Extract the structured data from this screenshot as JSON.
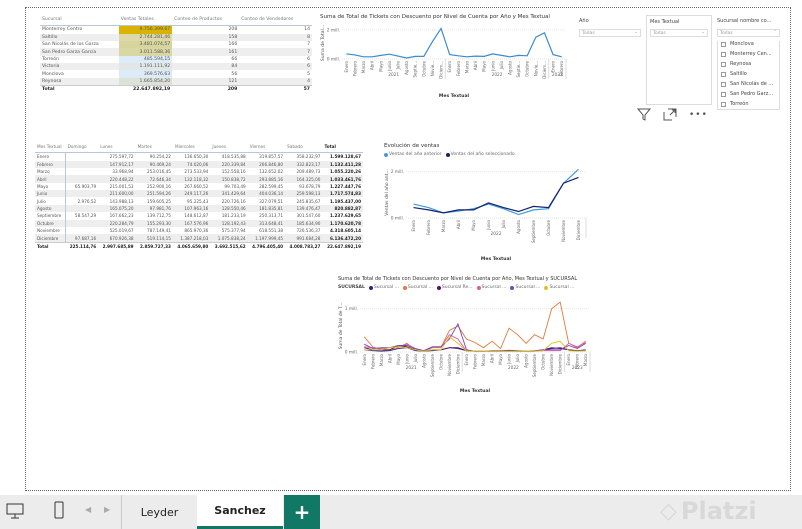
{
  "sales_table": {
    "headers": [
      "Sucursal",
      "Ventas Totales",
      "Conteo de Productos",
      "Conteo de Vendedores"
    ],
    "rows": [
      [
        "Monterrey Centro",
        "9.756.399,67",
        "208",
        "14"
      ],
      [
        "Saltillo",
        "2.744.281,46",
        "158",
        "8"
      ],
      [
        "San Nicolás de los Garza",
        "3.481.074,57",
        "166",
        "7"
      ],
      [
        "San Pedro Garza García",
        "3.011.588,36",
        "161",
        "7"
      ],
      [
        "Torreón",
        "485.594,15",
        "66",
        "6"
      ],
      [
        "Victoria",
        "1.191.111,92",
        "84",
        "6"
      ],
      [
        "Monclova",
        "369.576,63",
        "56",
        "5"
      ],
      [
        "Reynosa",
        "1.665.854,20",
        "121",
        "4"
      ]
    ],
    "total": [
      "Total",
      "22.647.892,19",
      "209",
      "57"
    ],
    "bar_colors": [
      "#d9b300",
      "#dcd9a8",
      "#d7d49e",
      "#d9d7a3",
      "#ddeaf7",
      "#e1e6e6",
      "#ddeaf7",
      "#dde2d8"
    ]
  },
  "matrix": {
    "headers": [
      "Mes Textual",
      "Domingo",
      "Lunes",
      "Martes",
      "Miercoles",
      "Jueves",
      "Viernes",
      "Sabado",
      "Total"
    ],
    "rows": [
      [
        "Enero",
        "",
        "275.597,72",
        "90.254,22",
        "136.650,30",
        "418.535,88",
        "319.857,57",
        "358.232,97",
        "1.599.128,67"
      ],
      [
        "Febrero",
        "",
        "147.912,17",
        "90.469,24",
        "74.020,06",
        "220.339,84",
        "266.846,80",
        "332.823,17",
        "1.132.411,28"
      ],
      [
        "Marzo",
        "",
        "33.968,94",
        "253.016,45",
        "273.533,94",
        "152.558,16",
        "132.652,02",
        "209.489,73",
        "1.055.220,26"
      ],
      [
        "Abril",
        "",
        "220.448,22",
        "72.646,34",
        "132.118,32",
        "150.838,72",
        "293.885,16",
        "164.325,00",
        "1.033.461,76"
      ],
      [
        "Mayo",
        "65.903,79",
        "215.001,53",
        "252.900,16",
        "267.660,52",
        "99.703,49",
        "282.599,45",
        "93.678,79",
        "1.227.447,76"
      ],
      [
        "Junio",
        "",
        "211.600,00",
        "251.594,26",
        "249.117,26",
        "341.429,64",
        "404.036,14",
        "259.598,13",
        "1.717.574,83"
      ],
      [
        "Julio",
        "2.976,52",
        "143.988,13",
        "159.605,25",
        "95.225,43",
        "220.726,16",
        "327.079,51",
        "245.835,67",
        "1.195.437,00"
      ],
      [
        "Agosto",
        "",
        "165.075,20",
        "97.981,76",
        "107.963,16",
        "128.550,46",
        "181.835,81",
        "139.476,47",
        "820.882,87"
      ],
      [
        "Septiembre",
        "58.547,29",
        "167.662,23",
        "139.712,75",
        "148.612,87",
        "181.233,19",
        "250.313,71",
        "301.547,60",
        "1.237.629,65"
      ],
      [
        "Octubre",
        "",
        "220.284,79",
        "155.293,30",
        "167.576,96",
        "128.192,43",
        "313.648,41",
        "185.634,90",
        "1.170.620,78"
      ],
      [
        "Noviembre",
        "",
        "525.019,67",
        "787.149,41",
        "865.970,36",
        "575.377,94",
        "618.551,38",
        "726.536,37",
        "4.318.605,14"
      ],
      [
        "Diciembre",
        "97.687,16",
        "670.926,38",
        "519.114,15",
        "1.387.218,03",
        "1.075.838,24",
        "1.197.999,45",
        "991.684,28",
        "6.136.472,20"
      ]
    ],
    "total": [
      "Total",
      "225.114,76",
      "2.997.685,89",
      "2.859.727,33",
      "4.065.659,80",
      "3.692.515,62",
      "4.796.405,40",
      "4.008.783,27",
      "22.647.892,19"
    ]
  },
  "slicers": {
    "year": {
      "label": "Año",
      "value": "Todas"
    },
    "month": {
      "label": "Mes Textual",
      "value": "Todas"
    },
    "branch": {
      "label": "Sucursal nombre co...",
      "value": "Todas",
      "items": [
        "Monclova",
        "Monterrey Cen...",
        "Reynosa",
        "Saltillo",
        "San Nicolás de ...",
        "San Pedro Garz...",
        "Torreón"
      ]
    }
  },
  "chart_data": [
    {
      "type": "line",
      "title": "Suma de Total de Tickets con Descuento por Nivel de Cuenta por Año y Mes Textual",
      "xlabel": "Mes Textual",
      "ylabel": "Suma de Total...",
      "yticks": [
        "0 mill.",
        "2 mill."
      ],
      "ylim": [
        0,
        2.2
      ],
      "x": [
        "Enero",
        "Febrero",
        "Marzo",
        "Abril",
        "Mayo",
        "Junio",
        "Julio",
        "Agosto",
        "Septie...",
        "Octubre",
        "Novie...",
        "Diciem...",
        "Enero",
        "Febrero",
        "Marzo",
        "Abril",
        "Mayo",
        "Junio",
        "Julio",
        "Agosto",
        "Septie...",
        "Octubre",
        "Novie...",
        "Diciem...",
        "Enero",
        "Febrero"
      ],
      "groups": [
        {
          "label": "2021",
          "n": 12
        },
        {
          "label": "2022",
          "n": 12
        },
        {
          "label": "2023",
          "n": 2
        }
      ],
      "series": [
        {
          "name": "Total",
          "color": "#3a8ad1",
          "values": [
            0.35,
            0.28,
            0.15,
            0.15,
            0.25,
            0.33,
            0.2,
            0.07,
            0.18,
            0.18,
            1.2,
            2.1,
            0.3,
            0.22,
            0.15,
            0.2,
            0.18,
            0.35,
            0.25,
            0.15,
            0.25,
            0.22,
            1.5,
            1.8,
            0.3,
            0.15
          ]
        }
      ]
    },
    {
      "type": "line",
      "title": "Evolución de ventas",
      "xlabel": "Mes Textual",
      "ylabel": "Ventas del año ant...",
      "yticks": [
        "0 mill.",
        "2 mill."
      ],
      "ylim": [
        0,
        2.2
      ],
      "x": [
        "Enero",
        "Febrero",
        "Marzo",
        "Abril",
        "Mayo",
        "Junio",
        "Julio",
        "Agosto",
        "Septiembre",
        "Octubre",
        "Noviembre",
        "Diciembre"
      ],
      "groups": [
        {
          "label": "2022",
          "n": 12
        }
      ],
      "series": [
        {
          "name": "Ventas del año anterior",
          "color": "#3f9be0",
          "values": [
            0.6,
            0.45,
            0.22,
            0.3,
            0.4,
            0.6,
            0.4,
            0.15,
            0.35,
            0.4,
            1.5,
            2.1
          ]
        },
        {
          "name": "Ventas del año seleccionado",
          "color": "#14236b",
          "values": [
            0.45,
            0.35,
            0.22,
            0.35,
            0.35,
            0.65,
            0.45,
            0.28,
            0.5,
            0.45,
            1.5,
            1.75
          ]
        }
      ]
    },
    {
      "type": "line",
      "title": "Suma de Total de Tickets con Descuento por Nivel de Cuenta por Año, Mes Textual y SUCURSAL",
      "legend_title": "SUCURSAL",
      "xlabel": "Mes Textual",
      "ylabel": "Suma de Total de T...",
      "yticks": [
        "0 mill.",
        "1 mill."
      ],
      "ylim": [
        0,
        1.2
      ],
      "x": [
        "Enero",
        "Febrero",
        "Marzo",
        "Abril",
        "Mayo",
        "Junio",
        "Julio",
        "Agosto",
        "Septiembre",
        "Octubre",
        "Noviembre",
        "Diciembre",
        "Enero",
        "Febrero",
        "Marzo",
        "Abril",
        "Mayo",
        "Junio",
        "Julio",
        "Agosto",
        "Septiembre",
        "Octubre",
        "Noviembre",
        "Diciembre",
        "Enero",
        "Febrero",
        "Marzo"
      ],
      "groups": [
        {
          "label": "2021",
          "n": 12
        },
        {
          "label": "2022",
          "n": 12
        },
        {
          "label": "2023",
          "n": 3
        }
      ],
      "series": [
        {
          "name": "Sucursal ...",
          "color": "#1f2a8c",
          "values": [
            0.05,
            0.03,
            0.02,
            0.03,
            0.08,
            0.1,
            0.03,
            0.02,
            0.03,
            0.05,
            0.1,
            0.08,
            0.03,
            0.02,
            0.02,
            0.03,
            0.03,
            0.04,
            0.03,
            0.02,
            0.03,
            0.05,
            0.1,
            0.08,
            0.05,
            0.03,
            0.05
          ]
        },
        {
          "name": "Sucursal ...",
          "color": "#e07a3a",
          "values": [
            0.35,
            0.12,
            0.05,
            0.05,
            0.1,
            0.2,
            0.05,
            0.02,
            0.1,
            0.1,
            0.5,
            0.6,
            0.3,
            0.22,
            0.1,
            0.25,
            0.08,
            0.55,
            0.4,
            0.2,
            0.4,
            0.3,
            1.0,
            1.15,
            0.2,
            0.1,
            0.25
          ]
        },
        {
          "name": "Sucursal Re...",
          "color": "#5a0f5a",
          "values": [
            0.1,
            0.05,
            0.05,
            0.05,
            0.15,
            0.12,
            0.05,
            0.02,
            0.05,
            0.05,
            0.1,
            0.1,
            0.03,
            0.02,
            0.02,
            0.02,
            0.02,
            0.03,
            0.02,
            0.02,
            0.02,
            0.05,
            0.08,
            0.1,
            0.05,
            0.03,
            0.03
          ]
        },
        {
          "name": "Sucursal ...",
          "color": "#e05aa8",
          "values": [
            0.12,
            0.1,
            0.08,
            0.1,
            0.12,
            0.18,
            0.08,
            0.03,
            0.12,
            0.12,
            0.4,
            0.3,
            0.02,
            0.02,
            0.02,
            0.02,
            0.02,
            0.02,
            0.02,
            0.02,
            0.02,
            0.03,
            0.03,
            0.03,
            0.2,
            0.12,
            0.22
          ]
        },
        {
          "name": "Sucursal ...",
          "color": "#7048b8",
          "values": [
            0.18,
            0.08,
            0.1,
            0.1,
            0.15,
            0.15,
            0.08,
            0.03,
            0.12,
            0.12,
            0.3,
            0.65,
            0.05,
            0.02,
            0.02,
            0.02,
            0.02,
            0.02,
            0.02,
            0.02,
            0.02,
            0.05,
            0.05,
            0.05,
            0.15,
            0.08,
            0.2
          ]
        },
        {
          "name": "Sucursal ...",
          "color": "#e0c21a",
          "values": [
            0.05,
            0.05,
            0.05,
            0.1,
            0.12,
            0.1,
            0.05,
            0.02,
            0.05,
            0.05,
            0.35,
            0.2,
            0.02,
            0.02,
            0.02,
            0.02,
            0.02,
            0.02,
            0.02,
            0.02,
            0.02,
            0.03,
            0.2,
            0.25,
            0.03,
            0.02,
            0.03
          ]
        }
      ]
    }
  ],
  "bottom": {
    "tabs": [
      "Leyder",
      "Sanchez"
    ],
    "active": "Sanchez",
    "add": "+",
    "watermark": "Platzi"
  }
}
